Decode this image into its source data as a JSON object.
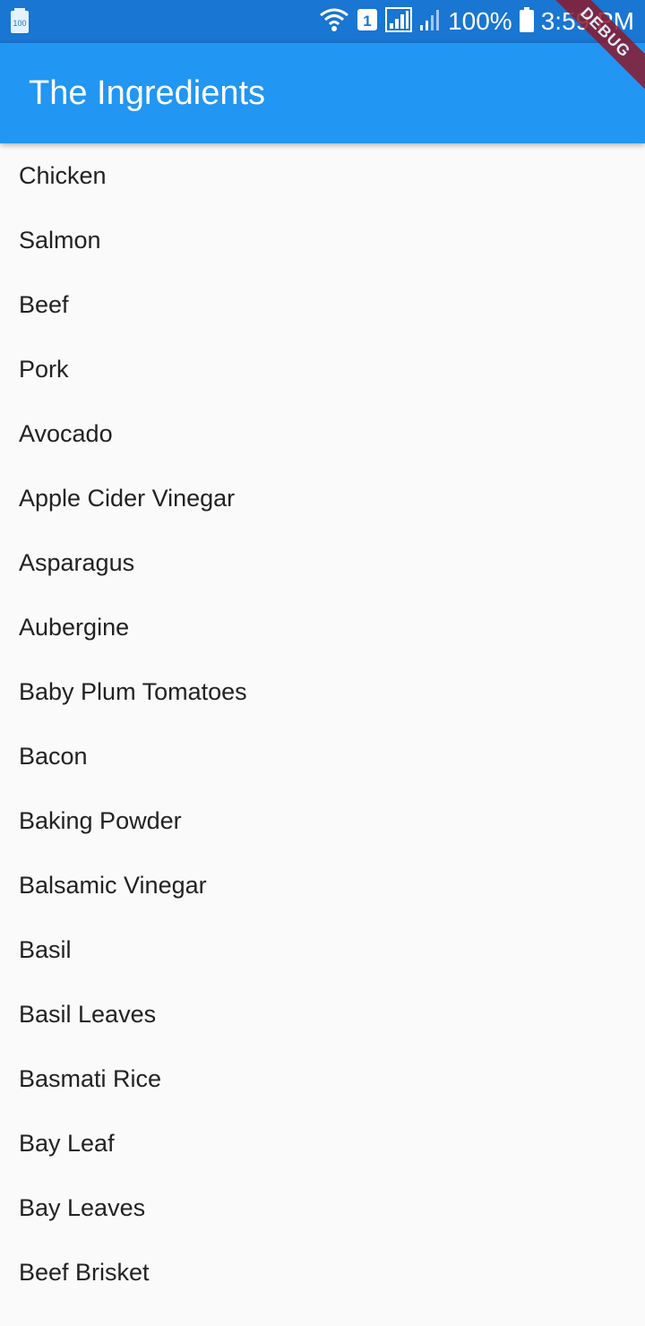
{
  "status_bar": {
    "battery_percent": "100%",
    "time": "3:59 PM",
    "sim_slot": "1",
    "left_icon_label": "100",
    "bg_color": "#1976d2"
  },
  "app_bar": {
    "title": "The Ingredients",
    "bg_color": "#2196f3"
  },
  "debug_banner": {
    "label": "DEBUG",
    "color": "#8b1a2e"
  },
  "ingredients": [
    "Chicken",
    "Salmon",
    "Beef",
    "Pork",
    "Avocado",
    "Apple Cider Vinegar",
    "Asparagus",
    "Aubergine",
    "Baby Plum Tomatoes",
    "Bacon",
    "Baking Powder",
    "Balsamic Vinegar",
    "Basil",
    "Basil Leaves",
    "Basmati Rice",
    "Bay Leaf",
    "Bay Leaves",
    "Beef Brisket"
  ]
}
